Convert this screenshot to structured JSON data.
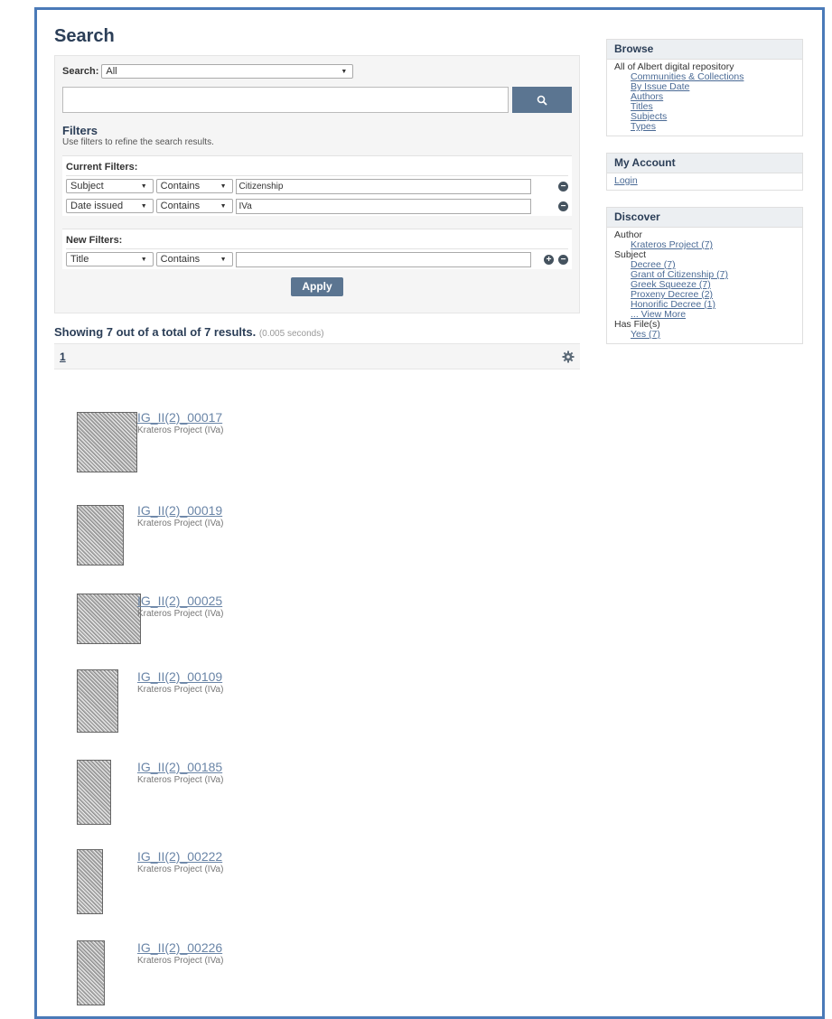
{
  "page": {
    "title": "Search"
  },
  "search": {
    "scope_label": "Search:",
    "scope_value": "All",
    "query_value": ""
  },
  "filters": {
    "title": "Filters",
    "help": "Use filters to refine the search results.",
    "current_label": "Current Filters:",
    "current": [
      {
        "field": "Subject",
        "op": "Contains",
        "value": "Citizenship"
      },
      {
        "field": "Date issued",
        "op": "Contains",
        "value": "IVa"
      }
    ],
    "new_label": "New Filters:",
    "new": {
      "field": "Title",
      "op": "Contains",
      "value": ""
    },
    "apply_label": "Apply"
  },
  "results": {
    "summary": "Showing 7 out of a total of 7 results.",
    "time": "(0.005 seconds)",
    "page_number": "1",
    "items": [
      {
        "title": "IG_II(2)_00017",
        "subtitle": "Krateros Project (IVa)"
      },
      {
        "title": "IG_II(2)_00019",
        "subtitle": "Krateros Project (IVa)"
      },
      {
        "title": "IG_II(2)_00025",
        "subtitle": "Krateros Project (IVa)"
      },
      {
        "title": "IG_II(2)_00109",
        "subtitle": "Krateros Project (IVa)"
      },
      {
        "title": "IG_II(2)_00185",
        "subtitle": "Krateros Project (IVa)"
      },
      {
        "title": "IG_II(2)_00222",
        "subtitle": "Krateros Project (IVa)"
      },
      {
        "title": "IG_II(2)_00226",
        "subtitle": "Krateros Project (IVa)"
      }
    ]
  },
  "sidebar": {
    "browse": {
      "title": "Browse",
      "root": "All of Albert digital repository",
      "links": [
        "Communities & Collections",
        "By Issue Date",
        "Authors",
        "Titles",
        "Subjects",
        "Types"
      ]
    },
    "account": {
      "title": "My Account",
      "login": "Login"
    },
    "discover": {
      "title": "Discover",
      "author_label": "Author",
      "authors": [
        "Krateros Project (7)"
      ],
      "subject_label": "Subject",
      "subjects": [
        "Decree (7)",
        "Grant of Citizenship (7)",
        "Greek Squeeze (7)",
        "Proxeny Decree (2)",
        "Honorific Decree (1)",
        "... View More"
      ],
      "hasfile_label": "Has File(s)",
      "hasfile": [
        "Yes (7)"
      ]
    }
  }
}
